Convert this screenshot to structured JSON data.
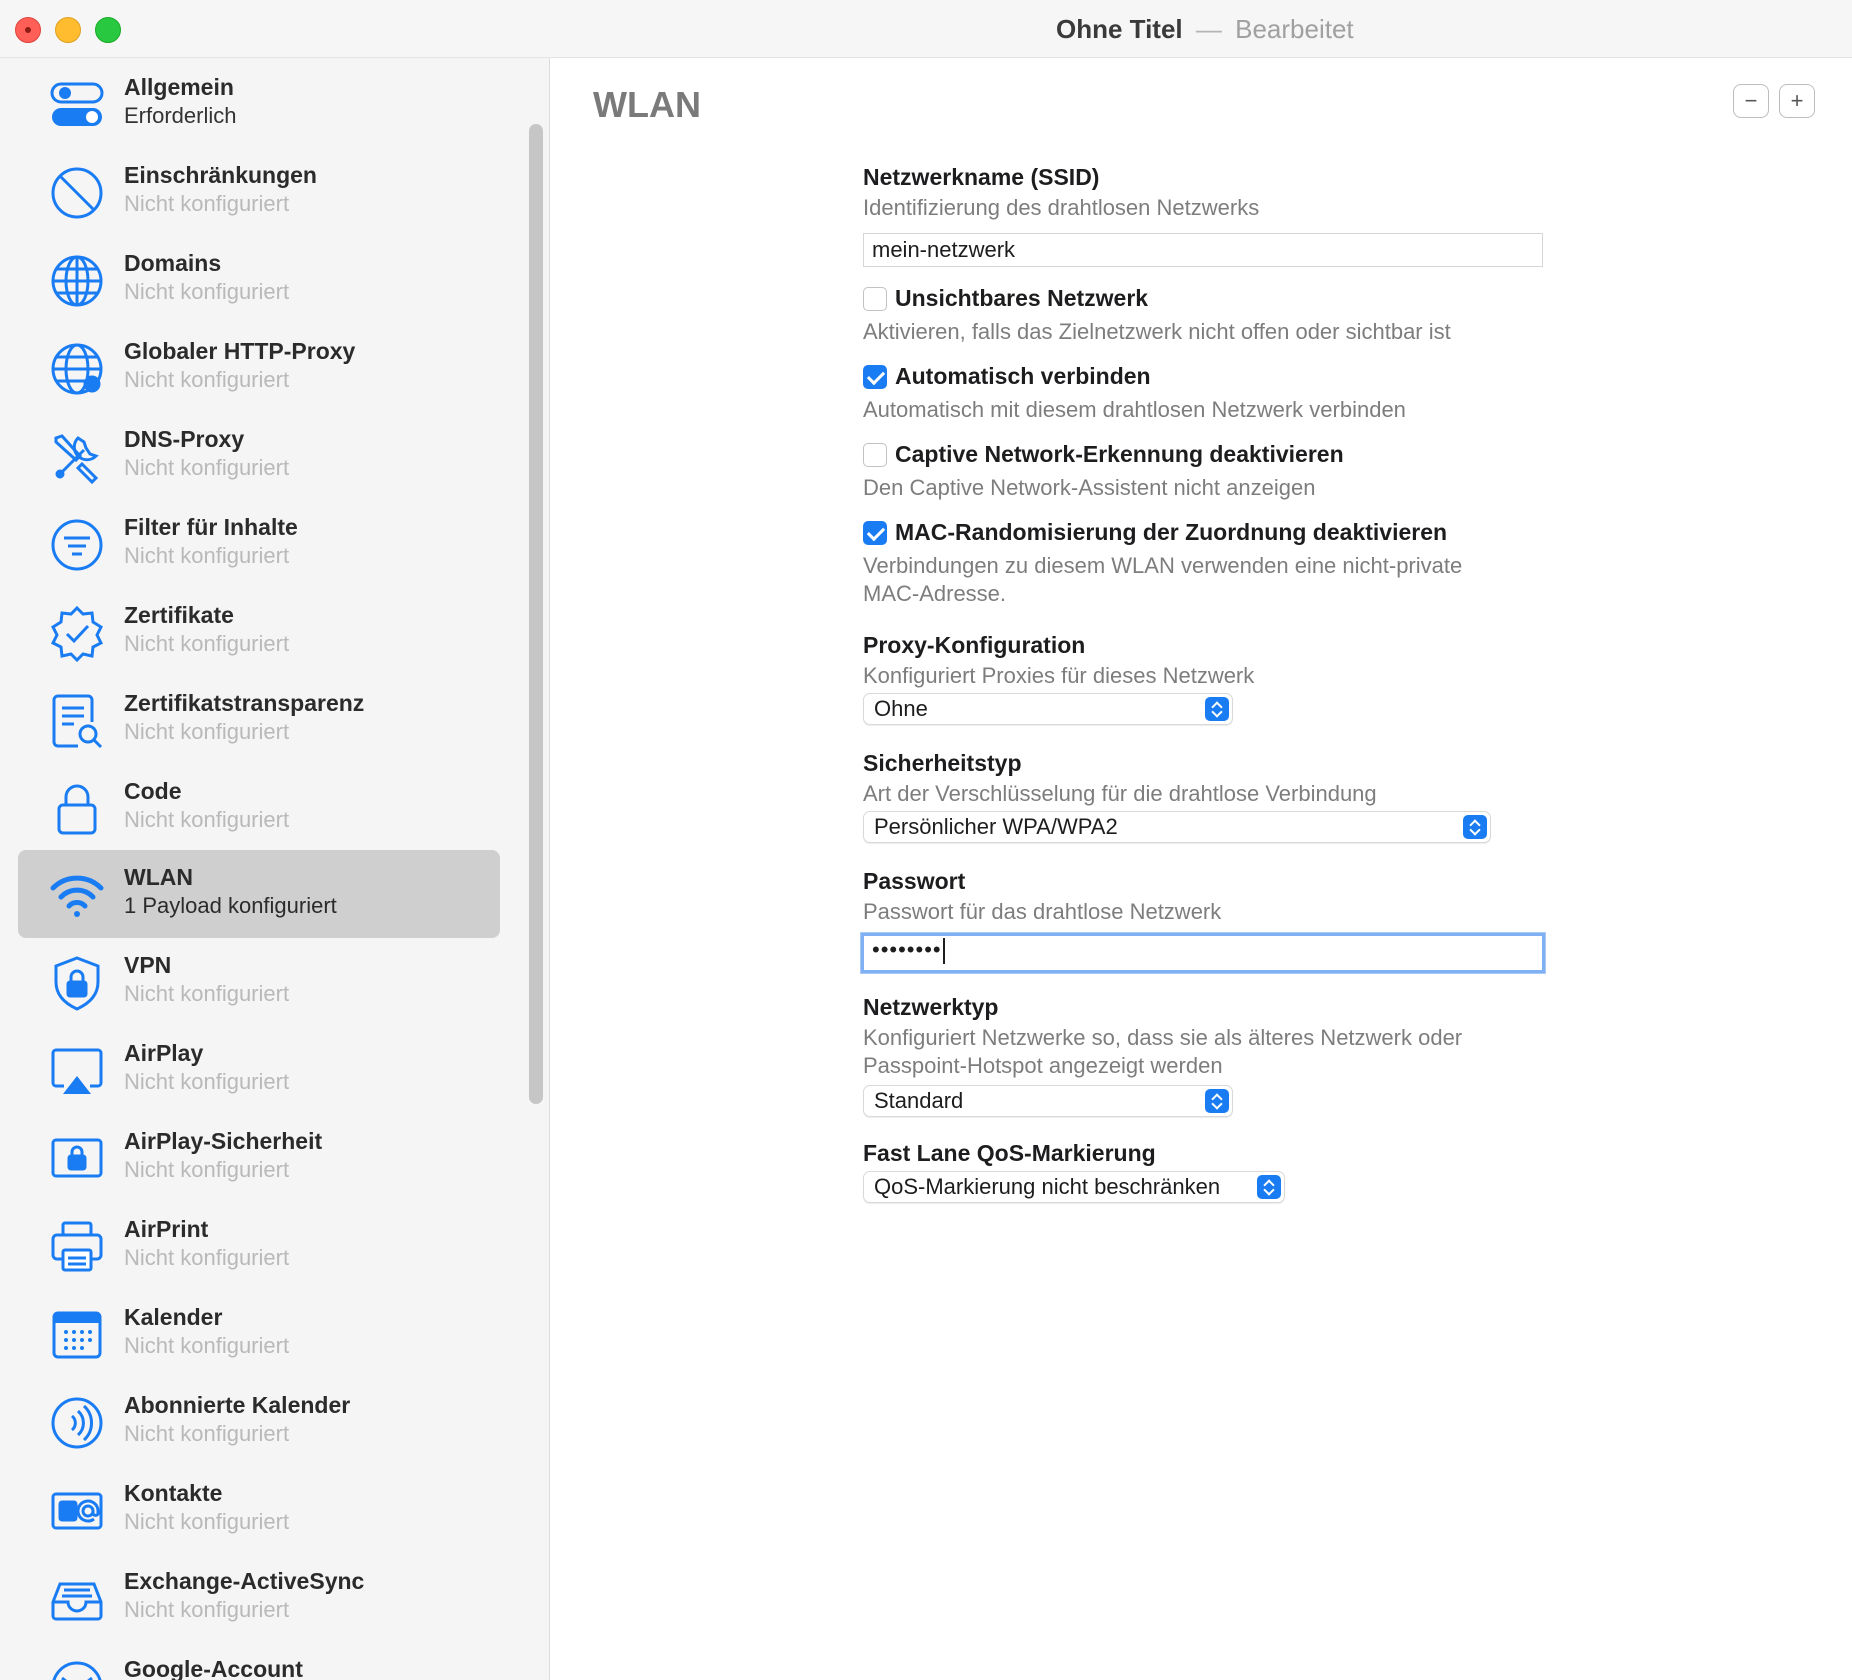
{
  "window": {
    "title": "Ohne Titel",
    "separator": "—",
    "status": "Bearbeitet"
  },
  "sidebar": {
    "items": [
      {
        "label": "Allgemein",
        "sub": "Erforderlich",
        "icon": "toggle-icon"
      },
      {
        "label": "Einschränkungen",
        "sub": "Nicht konfiguriert",
        "icon": "prohibited-icon"
      },
      {
        "label": "Domains",
        "sub": "Nicht konfiguriert",
        "icon": "globe-icon"
      },
      {
        "label": "Globaler HTTP-Proxy",
        "sub": "Nicht konfiguriert",
        "icon": "network-globe-icon"
      },
      {
        "label": "DNS-Proxy",
        "sub": "Nicht konfiguriert",
        "icon": "tools-icon"
      },
      {
        "label": "Filter für Inhalte",
        "sub": "Nicht konfiguriert",
        "icon": "filter-icon"
      },
      {
        "label": "Zertifikate",
        "sub": "Nicht konfiguriert",
        "icon": "certificate-seal-icon"
      },
      {
        "label": "Zertifikatstransparenz",
        "sub": "Nicht konfiguriert",
        "icon": "document-search-icon"
      },
      {
        "label": "Code",
        "sub": "Nicht konfiguriert",
        "icon": "lock-icon"
      },
      {
        "label": "WLAN",
        "sub": "1 Payload konfiguriert",
        "icon": "wifi-icon"
      },
      {
        "label": "VPN",
        "sub": "Nicht konfiguriert",
        "icon": "shield-lock-icon"
      },
      {
        "label": "AirPlay",
        "sub": "Nicht konfiguriert",
        "icon": "airplay-icon"
      },
      {
        "label": "AirPlay-Sicherheit",
        "sub": "Nicht konfiguriert",
        "icon": "airplay-lock-icon"
      },
      {
        "label": "AirPrint",
        "sub": "Nicht konfiguriert",
        "icon": "printer-icon"
      },
      {
        "label": "Kalender",
        "sub": "Nicht konfiguriert",
        "icon": "calendar-icon"
      },
      {
        "label": "Abonnierte Kalender",
        "sub": "Nicht konfiguriert",
        "icon": "broadcast-icon"
      },
      {
        "label": "Kontakte",
        "sub": "Nicht konfiguriert",
        "icon": "contact-card-icon"
      },
      {
        "label": "Exchange-ActiveSync",
        "sub": "Nicht konfiguriert",
        "icon": "inbox-tray-icon"
      },
      {
        "label": "Google-Account",
        "sub": "",
        "icon": "mail-icon"
      }
    ],
    "selected_index": 9
  },
  "main": {
    "title": "WLAN",
    "minus_label": "−",
    "plus_label": "+",
    "ssid": {
      "label": "Netzwerkname (SSID)",
      "desc": "Identifizierung des drahtlosen Netzwerks",
      "value": "mein-netzwerk"
    },
    "hidden_network": {
      "label": "Unsichtbares Netzwerk",
      "desc": "Aktivieren, falls das Zielnetzwerk nicht offen oder sichtbar ist",
      "checked": false
    },
    "auto_join": {
      "label": "Automatisch verbinden",
      "desc": "Automatisch mit diesem drahtlosen Netzwerk verbinden",
      "checked": true
    },
    "captive": {
      "label": "Captive Network-Erkennung deaktivieren",
      "desc": "Den Captive Network-Assistent nicht anzeigen",
      "checked": false
    },
    "mac": {
      "label": "MAC-Randomisierung der Zuordnung deaktivieren",
      "desc_line1": "Verbindungen zu diesem WLAN verwenden eine nicht-private",
      "desc_line2": "MAC-Adresse.",
      "checked": true
    },
    "proxy": {
      "label": "Proxy-Konfiguration",
      "desc": "Konfiguriert Proxies für dieses Netzwerk",
      "value": "Ohne"
    },
    "security": {
      "label": "Sicherheitstyp",
      "desc": "Art der Verschlüsselung für die drahtlose Verbindung",
      "value": "Persönlicher WPA/WPA2"
    },
    "password": {
      "label": "Passwort",
      "desc": "Passwort für das drahtlose Netzwerk",
      "value": "••••••••"
    },
    "network_type": {
      "label": "Netzwerktyp",
      "desc_line1": "Konfiguriert Netzwerke so, dass sie als älteres Netzwerk oder",
      "desc_line2": "Passpoint-Hotspot angezeigt werden",
      "value": "Standard"
    },
    "qos": {
      "label": "Fast Lane QoS-Markierung",
      "value": "QoS-Markierung nicht beschränken"
    }
  },
  "colors": {
    "accent": "#1a7cf3",
    "selected_row": "#cfcfcf",
    "muted_text": "#b9b9b9"
  }
}
